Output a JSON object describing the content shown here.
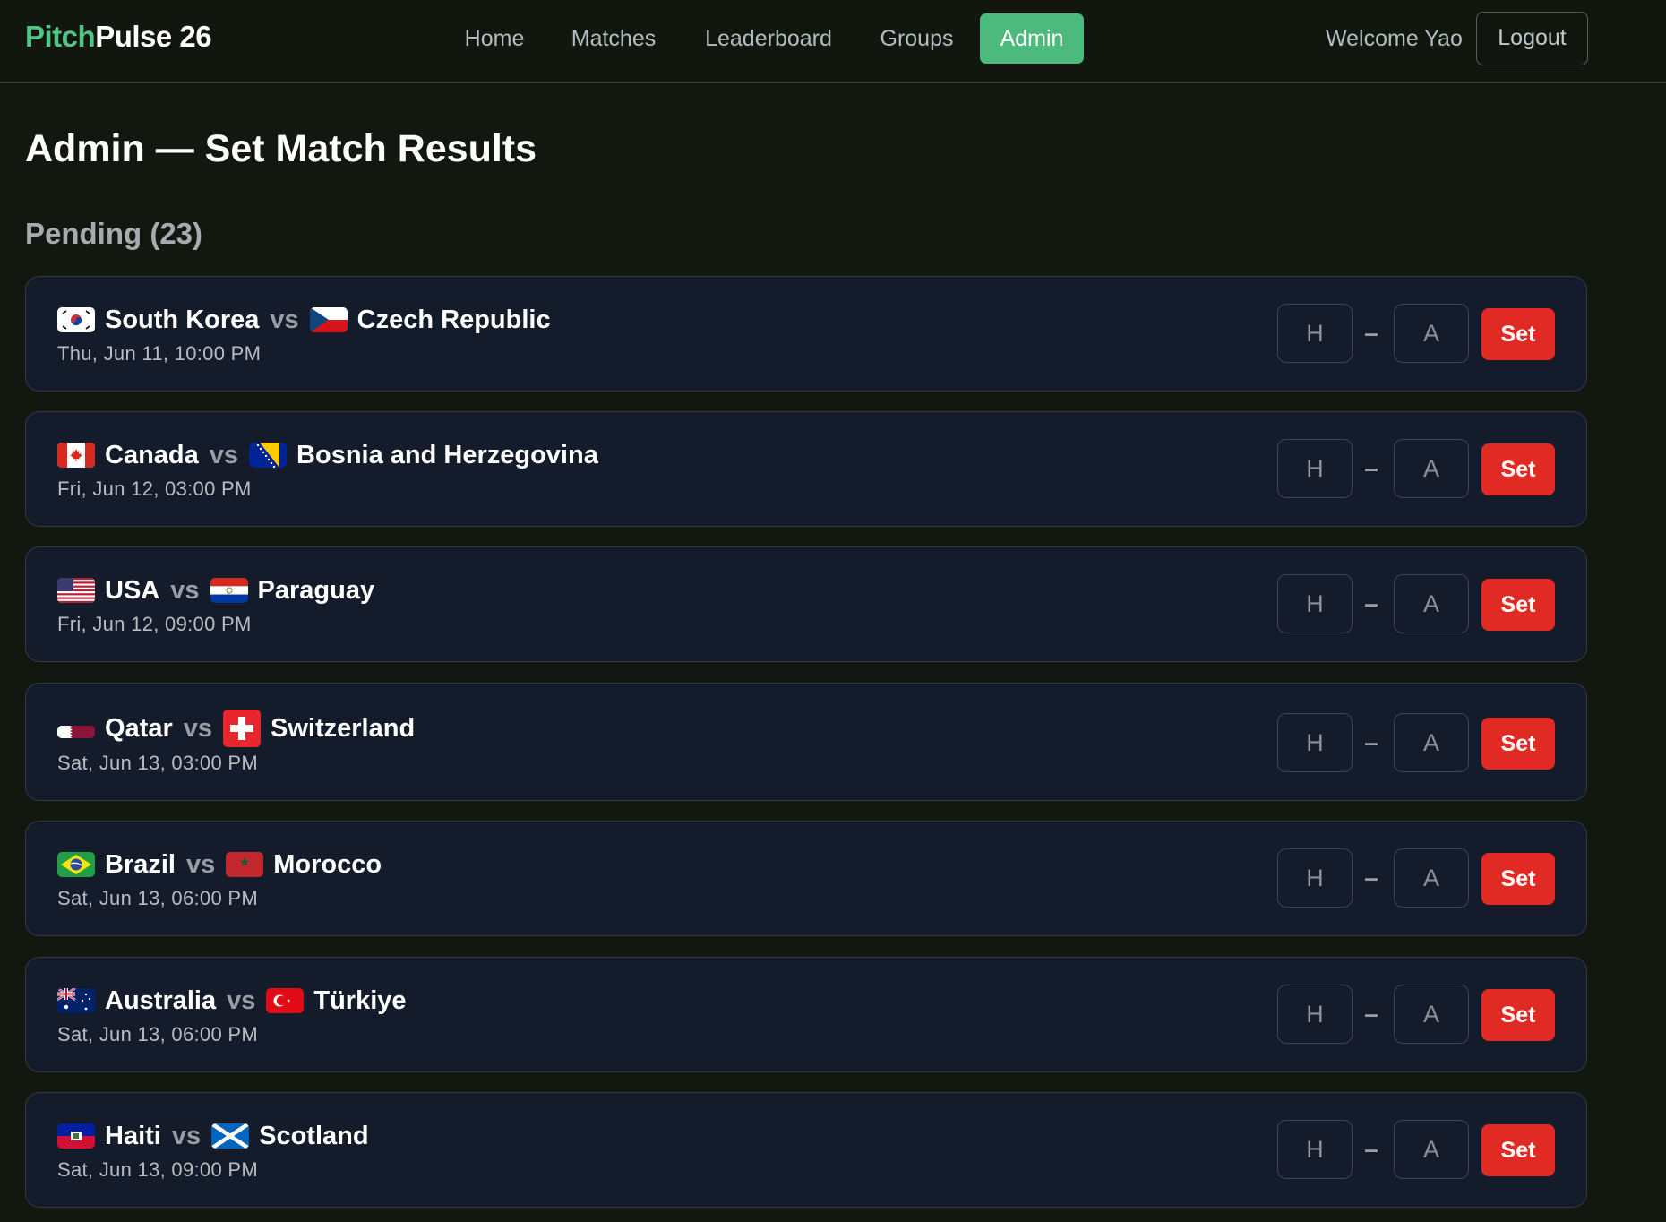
{
  "brand": {
    "accent": "Pitch",
    "rest": "Pulse 26"
  },
  "nav": {
    "home": "Home",
    "matches": "Matches",
    "leaderboard": "Leaderboard",
    "groups": "Groups",
    "admin": "Admin",
    "active": "Admin"
  },
  "user": {
    "welcome": "Welcome Yao",
    "logout": "Logout"
  },
  "page": {
    "title": "Admin — Set Match Results",
    "pending_heading": "Pending (23)"
  },
  "labels": {
    "vs": "vs",
    "dash": "–",
    "set": "Set",
    "home_placeholder": "H",
    "away_placeholder": "A"
  },
  "matches": [
    {
      "home": "South Korea",
      "home_flag": "south-korea-flag-icon",
      "away": "Czech Republic",
      "away_flag": "czech-republic-flag-icon",
      "date": "Thu, Jun 11, 10:00 PM"
    },
    {
      "home": "Canada",
      "home_flag": "canada-flag-icon",
      "away": "Bosnia and Herzegovina",
      "away_flag": "bosnia-flag-icon",
      "date": "Fri, Jun 12, 03:00 PM"
    },
    {
      "home": "USA",
      "home_flag": "usa-flag-icon",
      "away": "Paraguay",
      "away_flag": "paraguay-flag-icon",
      "date": "Fri, Jun 12, 09:00 PM"
    },
    {
      "home": "Qatar",
      "home_flag": "qatar-flag-icon",
      "away": "Switzerland",
      "away_flag": "switzerland-flag-icon",
      "date": "Sat, Jun 13, 03:00 PM"
    },
    {
      "home": "Brazil",
      "home_flag": "brazil-flag-icon",
      "away": "Morocco",
      "away_flag": "morocco-flag-icon",
      "date": "Sat, Jun 13, 06:00 PM"
    },
    {
      "home": "Australia",
      "home_flag": "australia-flag-icon",
      "away": "Türkiye",
      "away_flag": "turkiye-flag-icon",
      "date": "Sat, Jun 13, 06:00 PM"
    },
    {
      "home": "Haiti",
      "home_flag": "haiti-flag-icon",
      "away": "Scotland",
      "away_flag": "scotland-flag-icon",
      "date": "Sat, Jun 13, 09:00 PM"
    }
  ],
  "colors": {
    "background": "#121810",
    "card": "#141b2a",
    "accent_green": "#4dba7d",
    "set_button": "#e22a25"
  }
}
